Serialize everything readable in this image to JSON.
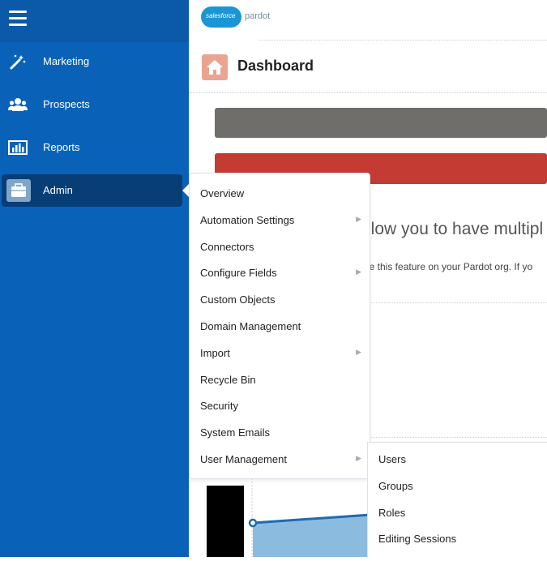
{
  "sidebar": {
    "items": [
      {
        "label": "Marketing",
        "icon": "magic-wand-icon"
      },
      {
        "label": "Prospects",
        "icon": "people-icon"
      },
      {
        "label": "Reports",
        "icon": "bar-chart-icon"
      },
      {
        "label": "Admin",
        "icon": "briefcase-icon"
      }
    ]
  },
  "header": {
    "logo_cloud": "salesforce",
    "logo_text": "pardot"
  },
  "page": {
    "title": "Dashboard",
    "banner_text": "llow you to have multipl",
    "banner_subtext": "le this feature on your Pardot org. If yo"
  },
  "admin_menu": {
    "items": [
      {
        "label": "Overview",
        "has_sub": false
      },
      {
        "label": "Automation Settings",
        "has_sub": true
      },
      {
        "label": "Connectors",
        "has_sub": false
      },
      {
        "label": "Configure Fields",
        "has_sub": true
      },
      {
        "label": "Custom Objects",
        "has_sub": false
      },
      {
        "label": "Domain Management",
        "has_sub": false
      },
      {
        "label": "Import",
        "has_sub": true
      },
      {
        "label": "Recycle Bin",
        "has_sub": false
      },
      {
        "label": "Security",
        "has_sub": false
      },
      {
        "label": "System Emails",
        "has_sub": false
      },
      {
        "label": "User Management",
        "has_sub": true
      }
    ]
  },
  "user_management_submenu": {
    "items": [
      {
        "label": "Users"
      },
      {
        "label": "Groups"
      },
      {
        "label": "Roles"
      },
      {
        "label": "Editing Sessions"
      }
    ]
  },
  "colors": {
    "sidebar": "#0a62b8",
    "sidebar_active": "#073e76",
    "gray_bar": "#706e6b",
    "red_bar": "#c33b33",
    "chart_line": "#1f6bb0",
    "chart_fill": "#8cbbe0"
  }
}
